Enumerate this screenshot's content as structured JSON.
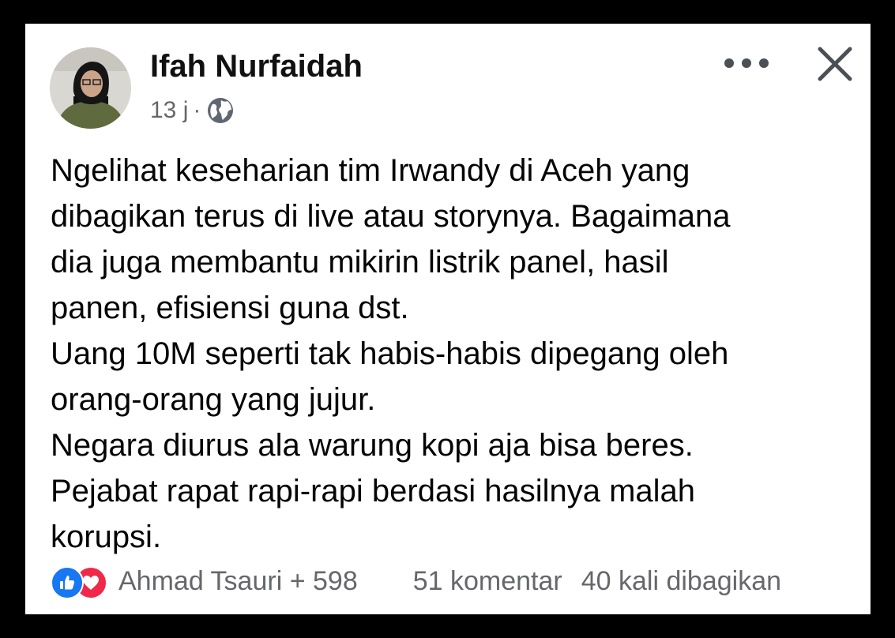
{
  "post": {
    "author": "Ifah Nurfaidah",
    "time": "13 j",
    "separator": "·",
    "audience_icon": "globe-icon",
    "lines": [
      "Ngelihat keseharian tim Irwandy di Aceh yang",
      "dibagikan terus di live atau storynya. Bagaimana",
      "dia juga membantu mikirin listrik panel, hasil",
      "panen, efisiensi guna dst.",
      "Uang 10M seperti tak habis-habis dipegang oleh",
      "orang-orang yang jujur.",
      "Negara diurus ala warung kopi aja bisa beres.",
      "Pejabat rapat rapi-rapi berdasi hasilnya malah",
      "korupsi."
    ]
  },
  "footer": {
    "reactors": "Ahmad Tsauri + 598",
    "comments": "51 komentar",
    "shares": "40 kali dibagikan"
  },
  "colors": {
    "background": "#000000",
    "card": "#ffffff",
    "like_blue": "#1877f2",
    "love_red": "#f02849",
    "secondary_text": "#65676b"
  }
}
